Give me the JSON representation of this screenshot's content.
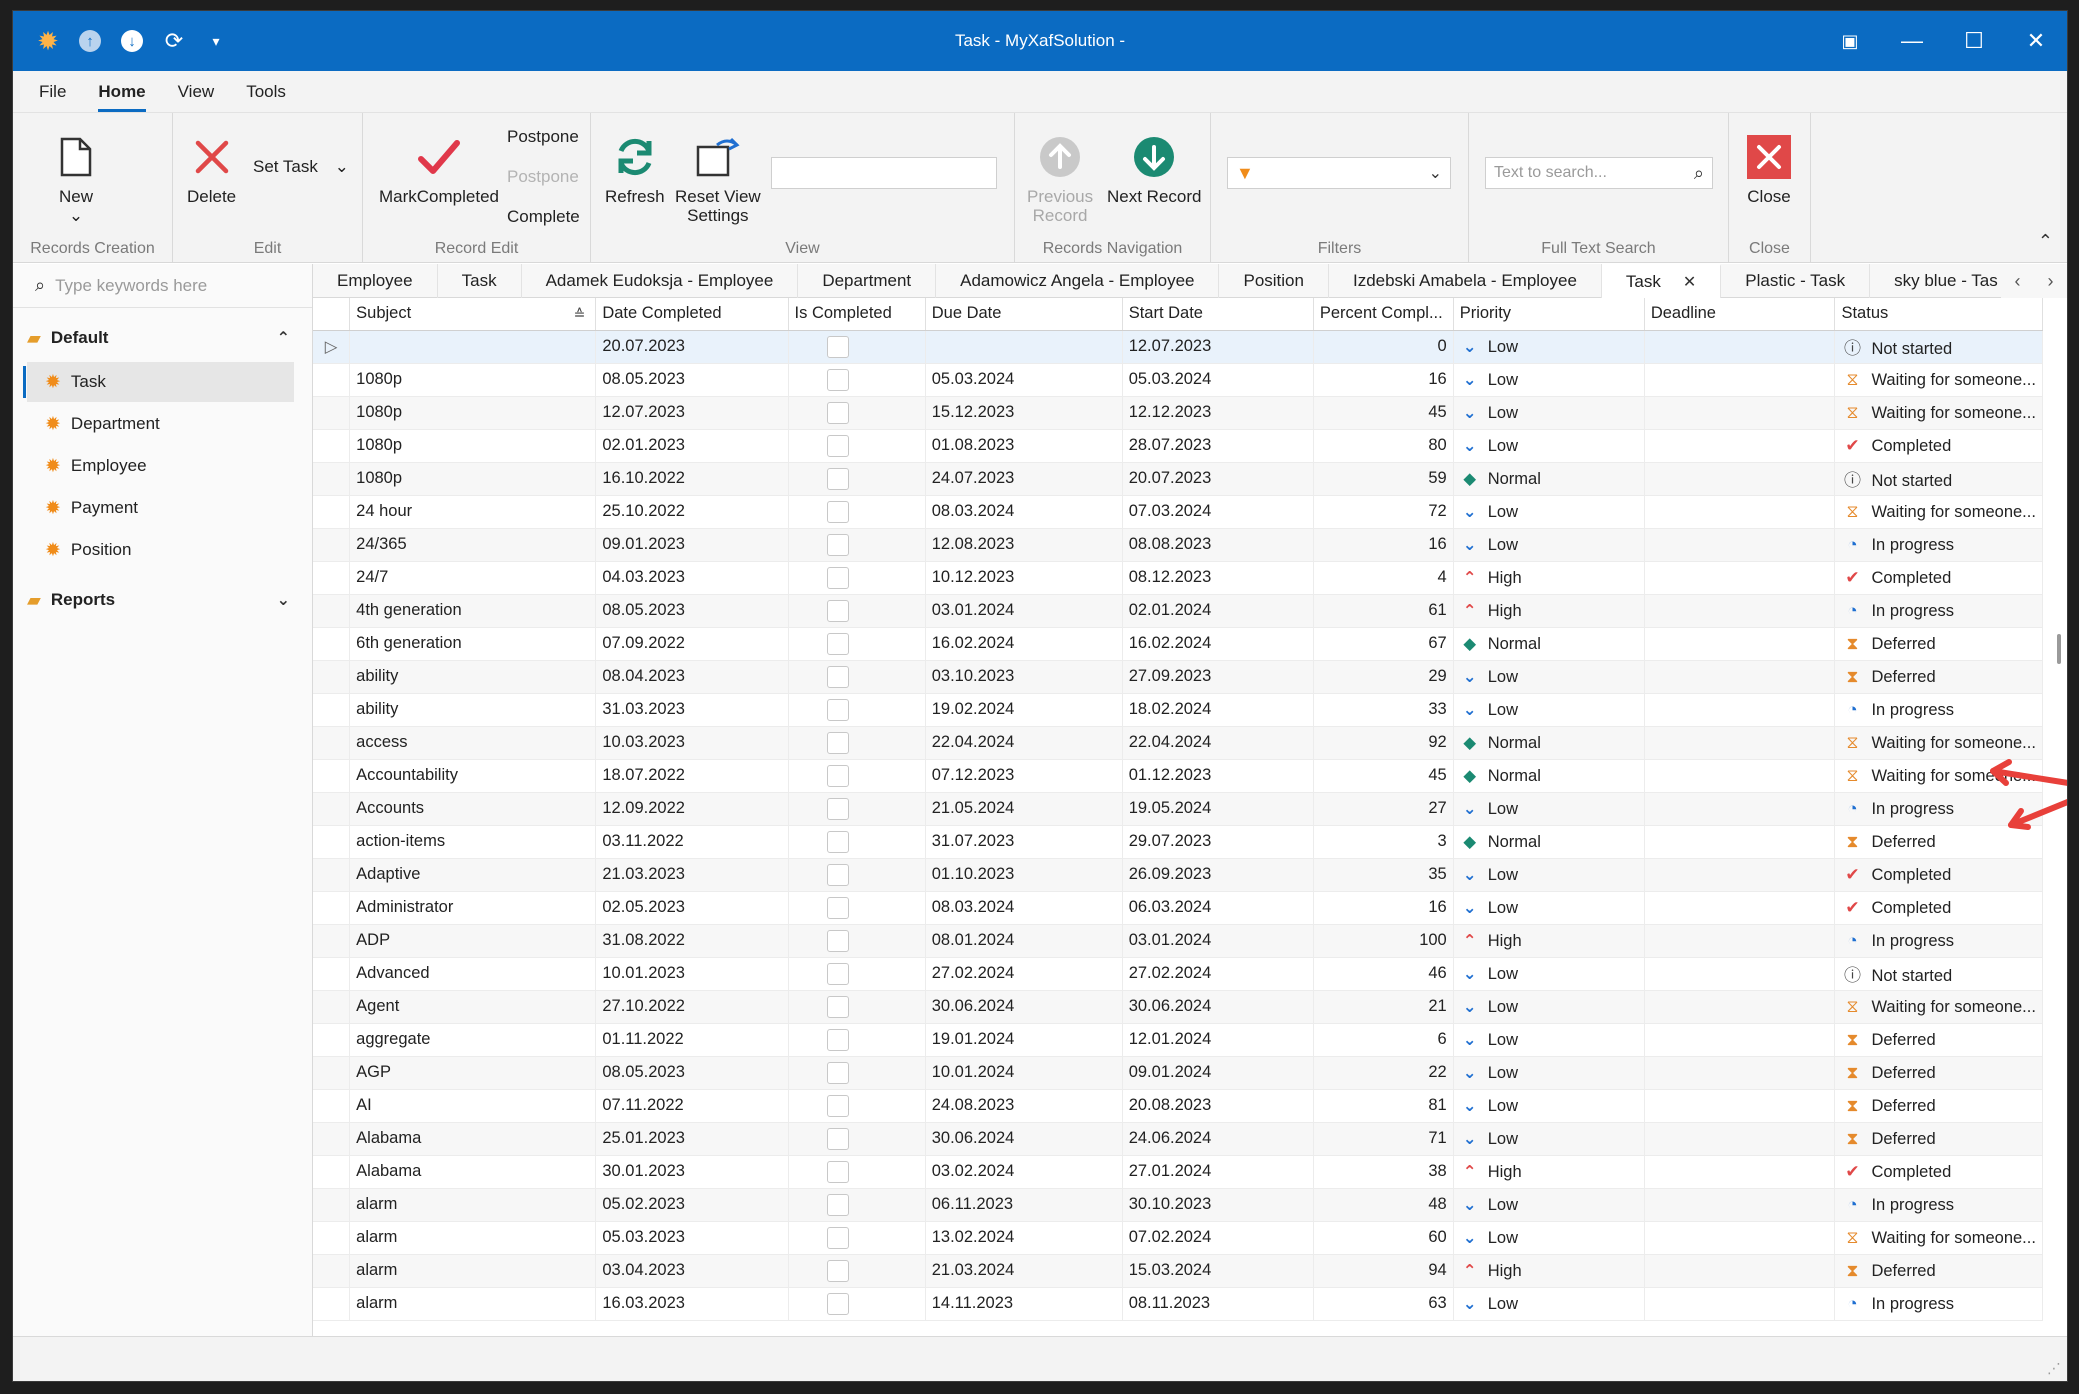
{
  "window": {
    "title": "Task - MyXafSolution -",
    "min_glyph": "—",
    "max_glyph": "☐",
    "close_glyph": "✕",
    "layout_glyph": "▣"
  },
  "titlebar_icons": [
    "app-logo-icon",
    "upload-icon",
    "download-icon",
    "refresh-icon",
    "customize-icon"
  ],
  "ribbon_tabs": [
    "File",
    "Home",
    "View",
    "Tools"
  ],
  "ribbon": {
    "records_creation": {
      "label": "Records Creation",
      "new": "New",
      "new_arrow": "⌄"
    },
    "edit": {
      "label": "Edit",
      "delete": "Delete",
      "set_task": "Set Task",
      "set_task_arrow": "⌄"
    },
    "record_edit": {
      "label": "Record Edit",
      "mark_completed": "MarkCompleted",
      "postpone1": "Postpone",
      "postpone2": "Postpone",
      "complete": "Complete"
    },
    "view": {
      "label": "View",
      "refresh": "Refresh",
      "reset_view_line1": "Reset View",
      "reset_view_line2": "Settings"
    },
    "records_navigation": {
      "label": "Records Navigation",
      "prev_line1": "Previous",
      "prev_line2": "Record",
      "next": "Next Record"
    },
    "filters": {
      "label": "Filters",
      "value": ""
    },
    "full_text_search": {
      "label": "Full Text Search",
      "placeholder": "Text to search..."
    },
    "close": {
      "label": "Close",
      "button": "Close"
    },
    "collapse_glyph": "⌃"
  },
  "nav": {
    "search_placeholder": "Type keywords here",
    "default_group": "Default",
    "items": [
      "Task",
      "Department",
      "Employee",
      "Payment",
      "Position"
    ],
    "reports_group": "Reports",
    "chev_up": "⌃",
    "chev_down": "⌄"
  },
  "doc_tabs": [
    "Employee",
    "Task",
    "Adamek Eudoksja - Employee",
    "Department",
    "Adamowicz Angela - Employee",
    "Position",
    "Izdebski Amabela - Employee",
    "Task",
    "Plastic - Task",
    "sky blue - Tas"
  ],
  "doc_tab_close": "✕",
  "doc_tab_dropdown": "⌄",
  "doc_tab_nav": {
    "prev": "‹",
    "next": "›"
  },
  "grid": {
    "columns": [
      "Subject",
      "Date Completed",
      "Is Completed",
      "Due Date",
      "Start Date",
      "Percent Compl...",
      "Priority",
      "Deadline",
      "Status"
    ],
    "row_indicator": "▷",
    "rows": [
      {
        "subject": "",
        "date_completed": "20.07.2023",
        "due": "",
        "start": "12.07.2023",
        "pct": "0",
        "priority": "Low",
        "status": "Not started"
      },
      {
        "subject": "1080p",
        "date_completed": "08.05.2023",
        "due": "05.03.2024",
        "start": "05.03.2024",
        "pct": "16",
        "priority": "Low",
        "status": "Waiting for someone..."
      },
      {
        "subject": "1080p",
        "date_completed": "12.07.2023",
        "due": "15.12.2023",
        "start": "12.12.2023",
        "pct": "45",
        "priority": "Low",
        "status": "Waiting for someone..."
      },
      {
        "subject": "1080p",
        "date_completed": "02.01.2023",
        "due": "01.08.2023",
        "start": "28.07.2023",
        "pct": "80",
        "priority": "Low",
        "status": "Completed"
      },
      {
        "subject": "1080p",
        "date_completed": "16.10.2022",
        "due": "24.07.2023",
        "start": "20.07.2023",
        "pct": "59",
        "priority": "Normal",
        "status": "Not started"
      },
      {
        "subject": "24 hour",
        "date_completed": "25.10.2022",
        "due": "08.03.2024",
        "start": "07.03.2024",
        "pct": "72",
        "priority": "Low",
        "status": "Waiting for someone..."
      },
      {
        "subject": "24/365",
        "date_completed": "09.01.2023",
        "due": "12.08.2023",
        "start": "08.08.2023",
        "pct": "16",
        "priority": "Low",
        "status": "In progress"
      },
      {
        "subject": "24/7",
        "date_completed": "04.03.2023",
        "due": "10.12.2023",
        "start": "08.12.2023",
        "pct": "4",
        "priority": "High",
        "status": "Completed"
      },
      {
        "subject": "4th generation",
        "date_completed": "08.05.2023",
        "due": "03.01.2024",
        "start": "02.01.2024",
        "pct": "61",
        "priority": "High",
        "status": "In progress"
      },
      {
        "subject": "6th generation",
        "date_completed": "07.09.2022",
        "due": "16.02.2024",
        "start": "16.02.2024",
        "pct": "67",
        "priority": "Normal",
        "status": "Deferred"
      },
      {
        "subject": "ability",
        "date_completed": "08.04.2023",
        "due": "03.10.2023",
        "start": "27.09.2023",
        "pct": "29",
        "priority": "Low",
        "status": "Deferred"
      },
      {
        "subject": "ability",
        "date_completed": "31.03.2023",
        "due": "19.02.2024",
        "start": "18.02.2024",
        "pct": "33",
        "priority": "Low",
        "status": "In progress"
      },
      {
        "subject": "access",
        "date_completed": "10.03.2023",
        "due": "22.04.2024",
        "start": "22.04.2024",
        "pct": "92",
        "priority": "Normal",
        "status": "Waiting for someone..."
      },
      {
        "subject": "Accountability",
        "date_completed": "18.07.2022",
        "due": "07.12.2023",
        "start": "01.12.2023",
        "pct": "45",
        "priority": "Normal",
        "status": "Waiting for someone..."
      },
      {
        "subject": "Accounts",
        "date_completed": "12.09.2022",
        "due": "21.05.2024",
        "start": "19.05.2024",
        "pct": "27",
        "priority": "Low",
        "status": "In progress"
      },
      {
        "subject": "action-items",
        "date_completed": "03.11.2022",
        "due": "31.07.2023",
        "start": "29.07.2023",
        "pct": "3",
        "priority": "Normal",
        "status": "Deferred"
      },
      {
        "subject": "Adaptive",
        "date_completed": "21.03.2023",
        "due": "01.10.2023",
        "start": "26.09.2023",
        "pct": "35",
        "priority": "Low",
        "status": "Completed"
      },
      {
        "subject": "Administrator",
        "date_completed": "02.05.2023",
        "due": "08.03.2024",
        "start": "06.03.2024",
        "pct": "16",
        "priority": "Low",
        "status": "Completed"
      },
      {
        "subject": "ADP",
        "date_completed": "31.08.2022",
        "due": "08.01.2024",
        "start": "03.01.2024",
        "pct": "100",
        "priority": "High",
        "status": "In progress"
      },
      {
        "subject": "Advanced",
        "date_completed": "10.01.2023",
        "due": "27.02.2024",
        "start": "27.02.2024",
        "pct": "46",
        "priority": "Low",
        "status": "Not started"
      },
      {
        "subject": "Agent",
        "date_completed": "27.10.2022",
        "due": "30.06.2024",
        "start": "30.06.2024",
        "pct": "21",
        "priority": "Low",
        "status": "Waiting for someone..."
      },
      {
        "subject": "aggregate",
        "date_completed": "01.11.2022",
        "due": "19.01.2024",
        "start": "12.01.2024",
        "pct": "6",
        "priority": "Low",
        "status": "Deferred"
      },
      {
        "subject": "AGP",
        "date_completed": "08.05.2023",
        "due": "10.01.2024",
        "start": "09.01.2024",
        "pct": "22",
        "priority": "Low",
        "status": "Deferred"
      },
      {
        "subject": "AI",
        "date_completed": "07.11.2022",
        "due": "24.08.2023",
        "start": "20.08.2023",
        "pct": "81",
        "priority": "Low",
        "status": "Deferred"
      },
      {
        "subject": "Alabama",
        "date_completed": "25.01.2023",
        "due": "30.06.2024",
        "start": "24.06.2024",
        "pct": "71",
        "priority": "Low",
        "status": "Deferred"
      },
      {
        "subject": "Alabama",
        "date_completed": "30.01.2023",
        "due": "03.02.2024",
        "start": "27.01.2024",
        "pct": "38",
        "priority": "High",
        "status": "Completed"
      },
      {
        "subject": "alarm",
        "date_completed": "05.02.2023",
        "due": "06.11.2023",
        "start": "30.10.2023",
        "pct": "48",
        "priority": "Low",
        "status": "In progress"
      },
      {
        "subject": "alarm",
        "date_completed": "05.03.2023",
        "due": "13.02.2024",
        "start": "07.02.2024",
        "pct": "60",
        "priority": "Low",
        "status": "Waiting for someone..."
      },
      {
        "subject": "alarm",
        "date_completed": "03.04.2023",
        "due": "21.03.2024",
        "start": "15.03.2024",
        "pct": "94",
        "priority": "High",
        "status": "Deferred"
      },
      {
        "subject": "alarm",
        "date_completed": "16.03.2023",
        "due": "14.11.2023",
        "start": "08.11.2023",
        "pct": "63",
        "priority": "Low",
        "status": "In progress"
      }
    ]
  },
  "icon_glyphs": {
    "priority": {
      "Low": "⌄",
      "High": "⌃",
      "Normal": "◆"
    },
    "status": {
      "Not started": "ⓘ",
      "Waiting for someone...": "⧖",
      "Completed": "✔",
      "In progress": "◔",
      "Deferred": "⧗"
    }
  },
  "colors": {
    "titlebar": "#0b6bc2",
    "accent": "#0b6bc2",
    "delete_red": "#e04848",
    "check_red": "#e0384a",
    "refresh_green": "#1b8a72",
    "next_green": "#1b8a72",
    "gear_orange": "#f08c1a",
    "annotation_arrow": "#e8403a"
  }
}
